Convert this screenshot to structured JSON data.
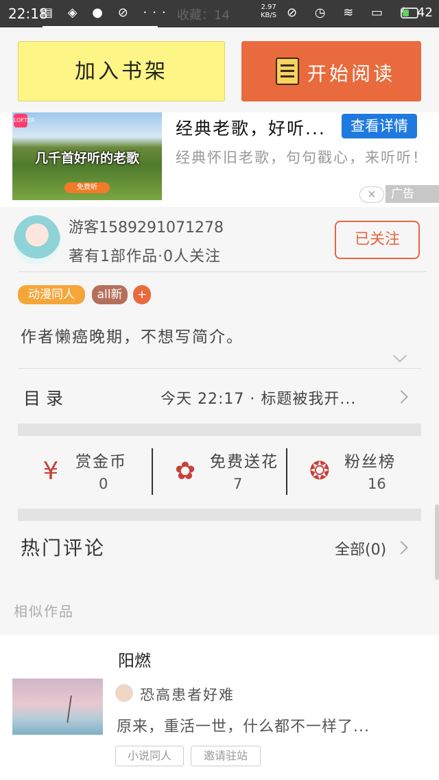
{
  "status_bar": {
    "time": "22:18",
    "left_icons": "▤ ◈ ● ⊘ ···",
    "ghost_text": "收藏：14",
    "speed_value": "2.97",
    "speed_unit": "KB/S",
    "right_icons": "⊘ ◷ ≋ ▭ ϟ",
    "battery": "42",
    "battery_level": 0.42
  },
  "actions": {
    "add_shelf": "加入书架",
    "start_reading": "开始阅读"
  },
  "ad": {
    "app_logo": "LOFTER",
    "image_text": "几千首好听的老歌",
    "image_button": "免费听",
    "title": "经典老歌，好听...",
    "detail_button": "查看详情",
    "description": "经典怀旧老歌，句句戳心，来听听！",
    "close": "✕",
    "badge": "广告"
  },
  "author": {
    "name": "游客1589291071278",
    "stats": "著有1部作品·0人关注",
    "follow_button": "已关注"
  },
  "tags": {
    "anime": "动漫同人",
    "all": "all新",
    "plus": "+"
  },
  "intro": "作者懒癌晚期，不想写简介。",
  "toc": {
    "label": "目录",
    "latest": "今天 22:17 · 标题被我开..."
  },
  "stats": [
    {
      "icon": "¥",
      "label": "赏金币",
      "value": "0"
    },
    {
      "icon": "✿",
      "label": "免费送花",
      "value": "7"
    },
    {
      "icon": "❂",
      "label": "粉丝榜",
      "value": "16"
    }
  ],
  "comments": {
    "title": "热门评论",
    "all": "全部(0)"
  },
  "similar": {
    "title": "相似作品",
    "book": {
      "title": "阳燃",
      "author": "恐高患者好难",
      "description": "原来，重活一世，什么都不一样了...",
      "tags": [
        "小说同人",
        "邀请驻站"
      ]
    }
  }
}
